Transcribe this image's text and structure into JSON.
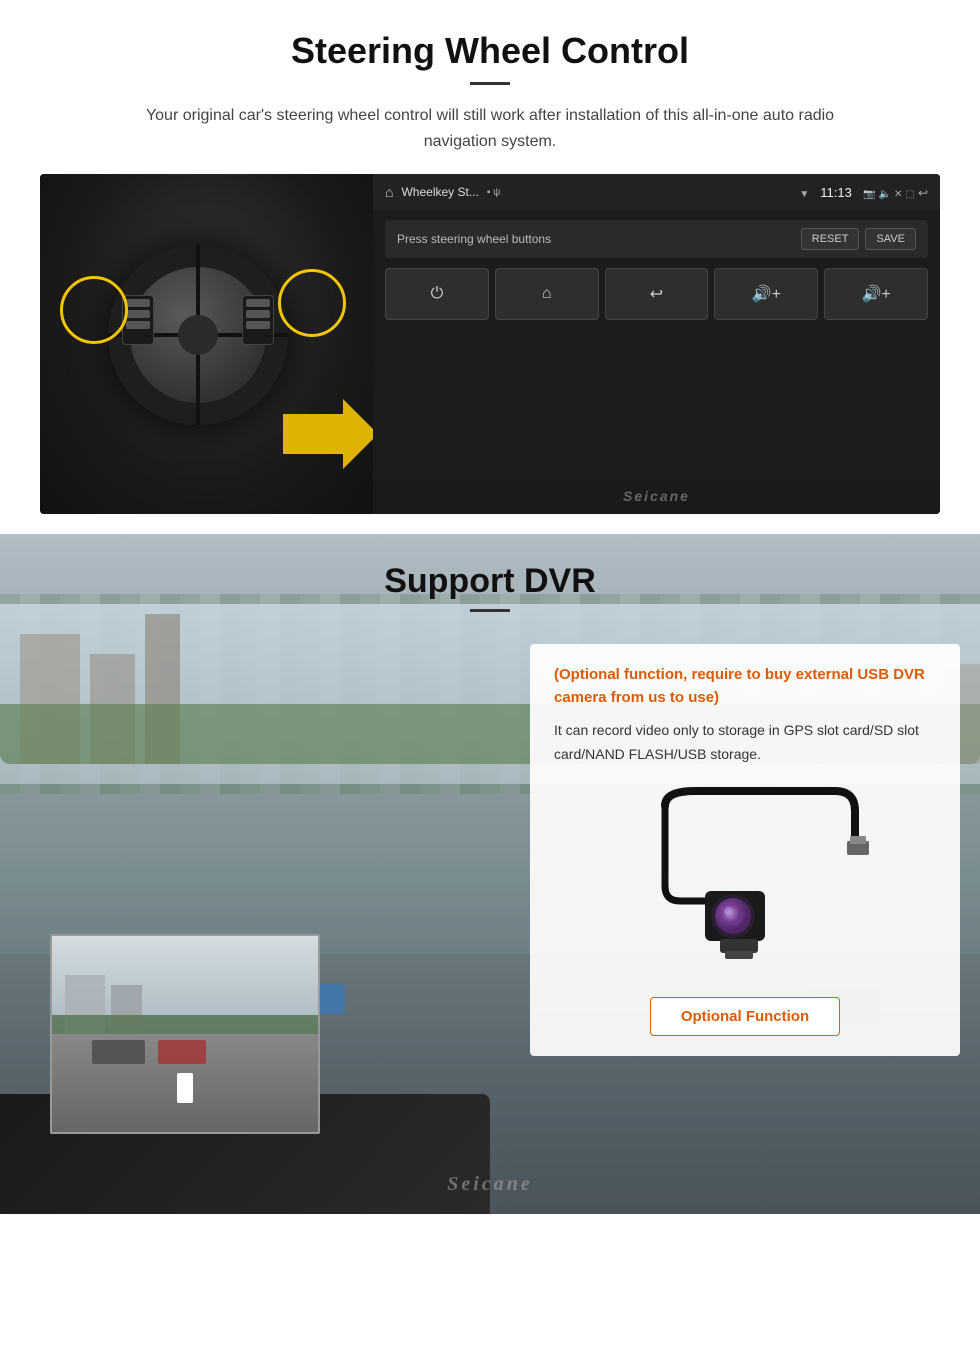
{
  "steering": {
    "title": "Steering Wheel Control",
    "description": "Your original car's steering wheel control will still work after installation of this all-in-one auto radio navigation system.",
    "android": {
      "app_label": "Wheelkey St...",
      "time": "11:13",
      "instruction": "Press steering wheel buttons",
      "btn_reset": "RESET",
      "btn_save": "SAVE",
      "buttons": [
        "⏻",
        "⌂",
        "↩",
        "🔊+",
        "🔊+"
      ]
    }
  },
  "dvr": {
    "title": "Support DVR",
    "optional_text": "(Optional function, require to buy external USB DVR camera from us to use)",
    "description": "It can record video only to storage in GPS slot card/SD slot card/NAND FLASH/USB storage.",
    "optional_function_btn": "Optional Function"
  },
  "watermark": "Seicane",
  "icons": {
    "home": "⌂",
    "power": "⏻",
    "back": "↩",
    "vol_up": "🔊"
  }
}
